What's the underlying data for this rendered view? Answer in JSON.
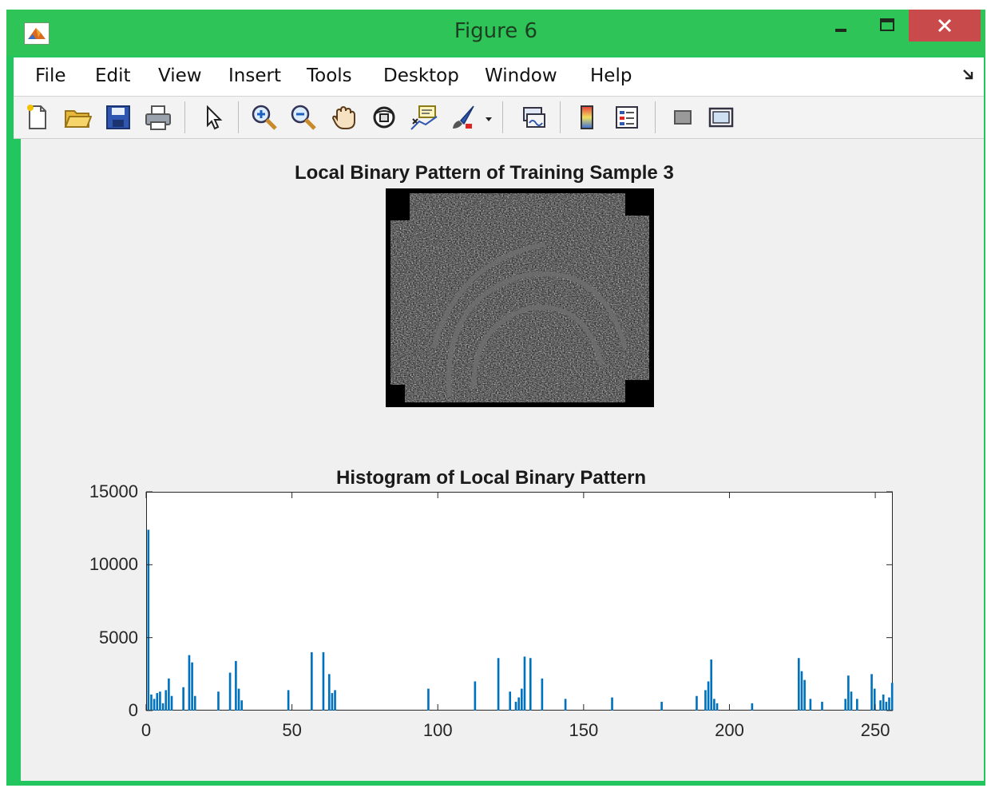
{
  "window": {
    "title": "Figure 6",
    "controls": {
      "minimize": "–",
      "maximize": "▭",
      "close": "✕"
    }
  },
  "menu": [
    "File",
    "Edit",
    "View",
    "Insert",
    "Tools",
    "Desktop",
    "Window",
    "Help"
  ],
  "menu_overflow_icon": "dock-arrow-icon",
  "toolbar": [
    "new-figure-icon",
    "open-file-icon",
    "save-icon",
    "print-icon",
    "edit-plot-arrow-icon",
    "zoom-in-icon",
    "zoom-out-icon",
    "pan-hand-icon",
    "rotate-3d-icon",
    "data-cursor-icon",
    "brush-icon",
    "brush-dropdown-icon",
    "link-plot-icon",
    "insert-colorbar-icon",
    "insert-legend-icon",
    "hide-plot-tools-icon",
    "show-plot-tools-icon"
  ],
  "figure": {
    "image_title": "Local Binary Pattern of Training Sample 3",
    "histogram_title": "Histogram of Local Binary Pattern"
  },
  "colors": {
    "window_frame": "#22c55e",
    "bar": "#0072bd",
    "close_button": "#c94a4a"
  },
  "chart_data": {
    "type": "bar",
    "title": "Histogram of Local Binary Pattern",
    "xlabel": "",
    "ylabel": "",
    "xlim": [
      0,
      256
    ],
    "ylim": [
      0,
      15000
    ],
    "xticks": [
      0,
      50,
      100,
      150,
      200,
      250
    ],
    "yticks": [
      0,
      5000,
      10000,
      15000
    ],
    "grid": false,
    "x": [
      0,
      1,
      2,
      3,
      4,
      5,
      6,
      7,
      8,
      12,
      14,
      15,
      16,
      24,
      28,
      30,
      31,
      32,
      48,
      56,
      60,
      62,
      63,
      64,
      96,
      112,
      120,
      124,
      126,
      127,
      128,
      129,
      131,
      135,
      143,
      159,
      176,
      188,
      191,
      192,
      193,
      194,
      195,
      207,
      223,
      224,
      225,
      227,
      231,
      239,
      240,
      241,
      243,
      248,
      249,
      251,
      252,
      253,
      254,
      255
    ],
    "values": [
      12400,
      1100,
      800,
      1200,
      1300,
      500,
      1400,
      2200,
      1000,
      1600,
      3800,
      3300,
      1000,
      1300,
      2600,
      3400,
      1500,
      700,
      1400,
      4000,
      4000,
      2500,
      1200,
      1400,
      1500,
      2000,
      3600,
      1300,
      600,
      900,
      1500,
      3700,
      3600,
      2200,
      800,
      900,
      600,
      1000,
      1400,
      2000,
      3500,
      800,
      500,
      500,
      3600,
      2700,
      2100,
      800,
      600,
      800,
      2400,
      1300,
      800,
      2500,
      1500,
      700,
      1100,
      600,
      900,
      1900
    ]
  }
}
